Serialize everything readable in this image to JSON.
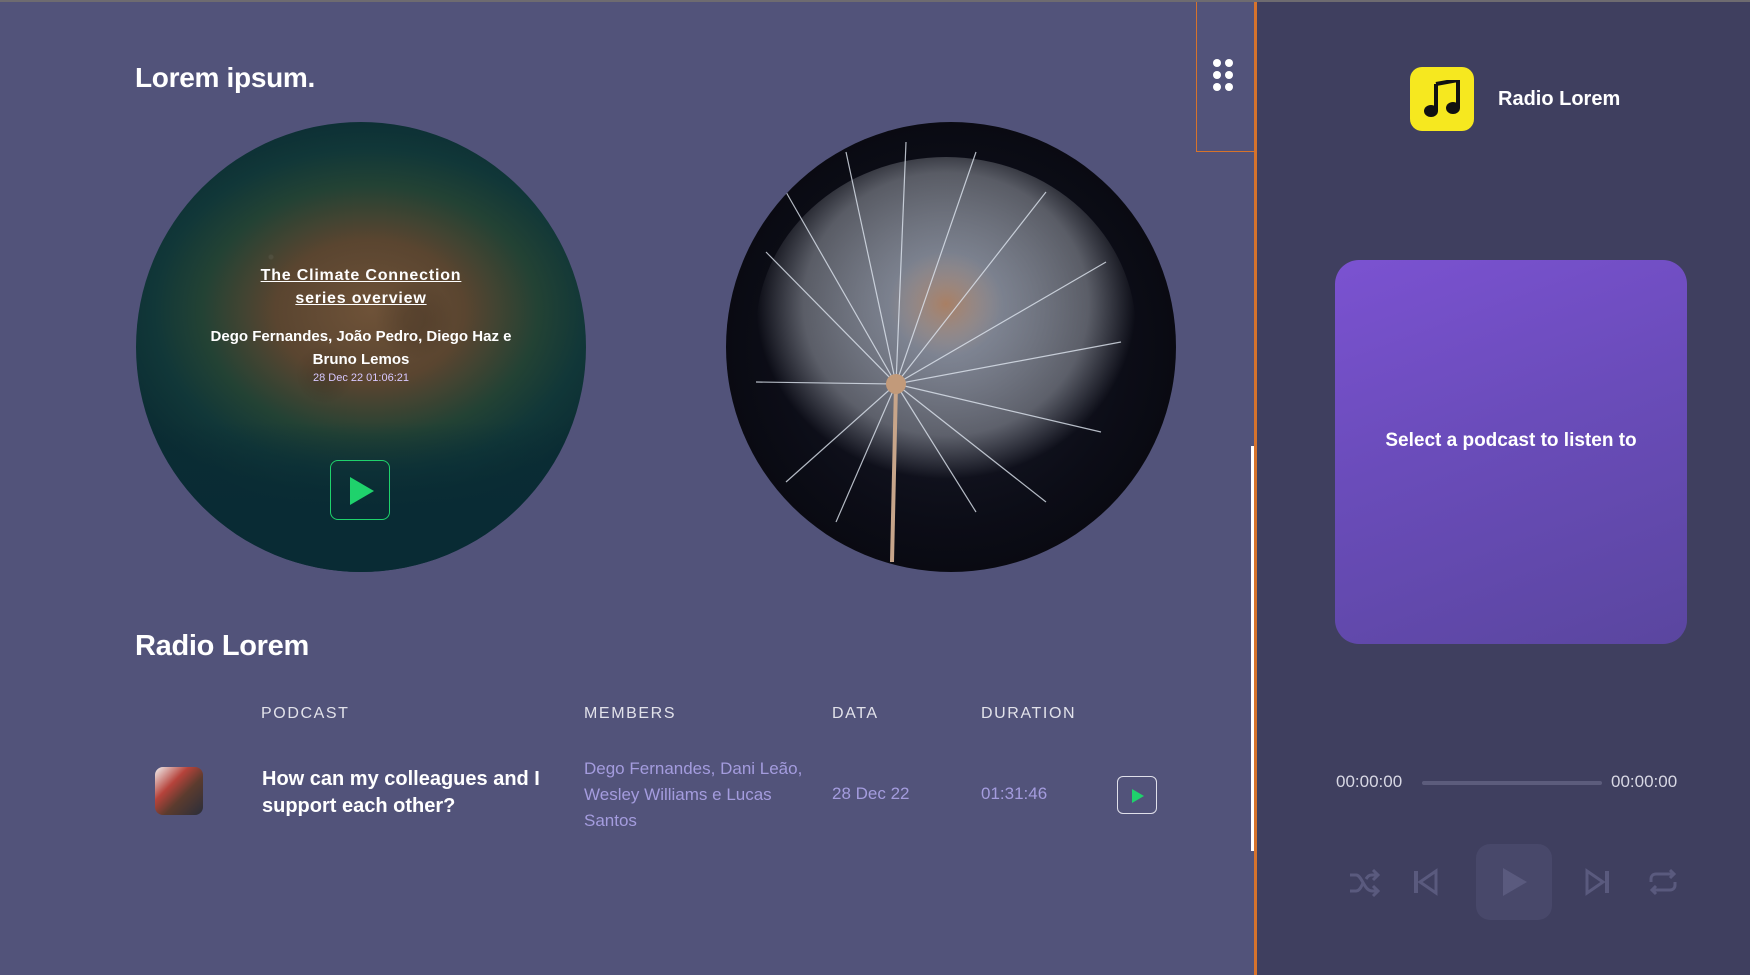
{
  "main": {
    "title": "Lorem ipsum.",
    "featured": [
      {
        "title_line1": "The Climate Connection",
        "title_line2": "series overview",
        "members": "Dego Fernandes, João Pedro, Diego Haz e Bruno Lemos",
        "date": "28 Dec 22 01:06:21"
      },
      {}
    ],
    "section_title": "Radio Lorem",
    "table": {
      "headers": {
        "podcast": "PODCAST",
        "members": "MEMBERS",
        "data": "DATA",
        "duration": "DURATION"
      },
      "rows": [
        {
          "title": "How can my colleagues and I support each other?",
          "members": "Dego Fernandes, Dani Leão, Wesley Williams e Lucas Santos",
          "date": "28 Dec 22",
          "duration": "01:31:46"
        }
      ]
    }
  },
  "player": {
    "brand": "Radio Lorem",
    "empty_message": "Select a podcast to listen to",
    "current_time": "00:00:00",
    "total_time": "00:00:00",
    "progress": 0
  },
  "colors": {
    "background": "#52537a",
    "panel": "#3f3f5f",
    "accent_orange": "#d6732c",
    "play_green": "#1fd26c",
    "logo_yellow": "#f6e81f",
    "card_purple": "#7b52d1",
    "muted_text": "#a49cde"
  },
  "icons": [
    "grid-menu-icon",
    "play-icon",
    "music-note-icon",
    "shuffle-icon",
    "skip-previous-icon",
    "skip-next-icon",
    "repeat-icon"
  ]
}
